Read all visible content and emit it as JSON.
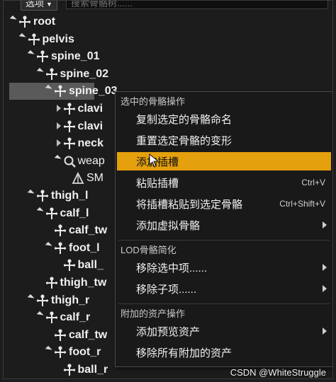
{
  "toolbar": {
    "options_label": "选项",
    "search_placeholder": "搜索骨骼树......"
  },
  "tree": {
    "rows": [
      {
        "label": "root",
        "depth": 0,
        "state": "expanded",
        "icon": "bone-icon",
        "bold": true
      },
      {
        "label": "pelvis",
        "depth": 1,
        "state": "expanded",
        "icon": "bone-icon",
        "bold": true
      },
      {
        "label": "spine_01",
        "depth": 2,
        "state": "expanded",
        "icon": "bone-icon",
        "bold": true
      },
      {
        "label": "spine_02",
        "depth": 3,
        "state": "expanded",
        "icon": "bone-icon",
        "bold": true
      },
      {
        "label": "spine_03",
        "depth": 4,
        "state": "expanded",
        "icon": "bone-icon",
        "bold": true,
        "selected": true
      },
      {
        "label": "clavi",
        "depth": 5,
        "state": "collapsed",
        "icon": "bone-icon",
        "bold": true
      },
      {
        "label": "clavi",
        "depth": 5,
        "state": "collapsed",
        "icon": "bone-icon",
        "bold": true
      },
      {
        "label": "neck",
        "depth": 5,
        "state": "collapsed",
        "icon": "bone-icon",
        "bold": true
      },
      {
        "label": "weap",
        "depth": 5,
        "state": "expanded",
        "icon": "socket-icon",
        "bold": false
      },
      {
        "label": "SM",
        "depth": 6,
        "state": "none",
        "icon": "mesh-icon",
        "bold": false
      },
      {
        "label": "thigh_l",
        "depth": 2,
        "state": "expanded",
        "icon": "bone-icon",
        "bold": true
      },
      {
        "label": "calf_l",
        "depth": 3,
        "state": "expanded",
        "icon": "bone-icon",
        "bold": true
      },
      {
        "label": "calf_tw",
        "depth": 4,
        "state": "none",
        "icon": "bone-icon",
        "bold": true
      },
      {
        "label": "foot_l",
        "depth": 4,
        "state": "expanded",
        "icon": "bone-icon",
        "bold": true
      },
      {
        "label": "ball_",
        "depth": 5,
        "state": "none",
        "icon": "bone-icon",
        "bold": true
      },
      {
        "label": "thigh_tw",
        "depth": 3,
        "state": "none",
        "icon": "bone-icon",
        "bold": true
      },
      {
        "label": "thigh_r",
        "depth": 2,
        "state": "expanded",
        "icon": "bone-icon",
        "bold": true
      },
      {
        "label": "calf_r",
        "depth": 3,
        "state": "expanded",
        "icon": "bone-icon",
        "bold": true
      },
      {
        "label": "calf_tw",
        "depth": 4,
        "state": "none",
        "icon": "bone-icon",
        "bold": true
      },
      {
        "label": "foot_r",
        "depth": 4,
        "state": "expanded",
        "icon": "bone-icon",
        "bold": true
      },
      {
        "label": "ball_r",
        "depth": 5,
        "state": "none",
        "icon": "bone-icon",
        "bold": true
      }
    ]
  },
  "context_menu": {
    "sections": [
      {
        "header": "选中的骨骼操作",
        "items": [
          {
            "label": "复制选定的骨骼命名",
            "shortcut": "",
            "submenu": false
          },
          {
            "label": "重置选定骨骼的变形",
            "shortcut": "",
            "submenu": false
          },
          {
            "label": "添加插槽",
            "shortcut": "",
            "submenu": false,
            "highlighted": true
          },
          {
            "label": "粘贴插槽",
            "shortcut": "Ctrl+V",
            "submenu": false
          },
          {
            "label": "将插槽粘贴到选定骨骼",
            "shortcut": "Ctrl+Shift+V",
            "submenu": false
          },
          {
            "label": "添加虚拟骨骼",
            "shortcut": "",
            "submenu": true
          }
        ]
      },
      {
        "header": "LOD骨骼简化",
        "items": [
          {
            "label": "移除选中项......",
            "shortcut": "",
            "submenu": true
          },
          {
            "label": "移除子项......",
            "shortcut": "",
            "submenu": true
          }
        ]
      },
      {
        "header": "附加的资产操作",
        "items": [
          {
            "label": "添加预览资产",
            "shortcut": "",
            "submenu": true
          },
          {
            "label": "移除所有附加的资产",
            "shortcut": "",
            "submenu": false
          }
        ]
      }
    ]
  },
  "watermark": "CSDN @WhiteStruggle",
  "colors": {
    "highlight": "#e5a00d",
    "selected_row": "#5a5a5a",
    "background": "#1c1c1c"
  }
}
